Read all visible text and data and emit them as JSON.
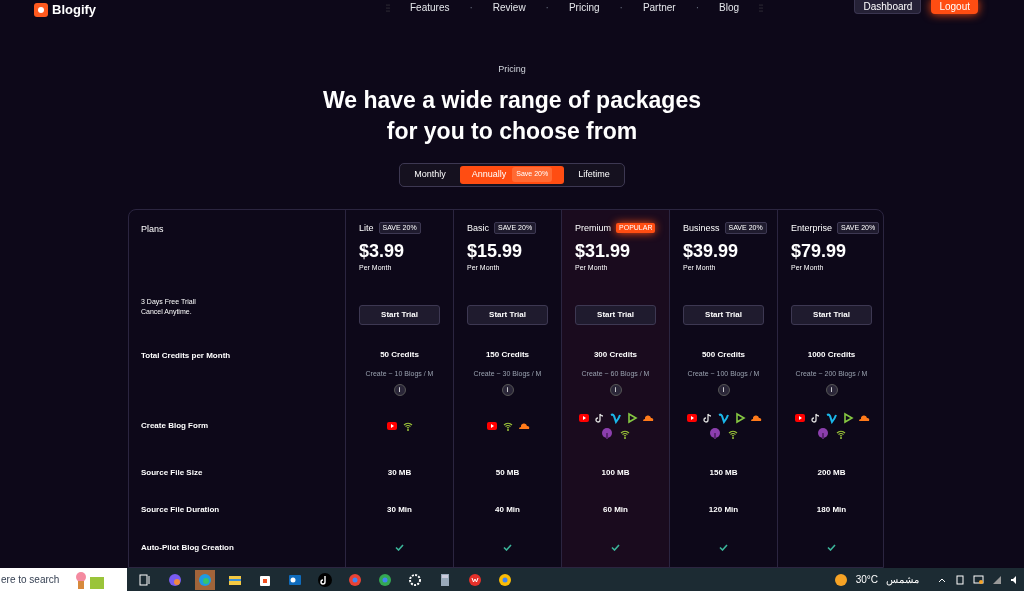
{
  "nav": {
    "brand": "Blogify",
    "links": [
      "Features",
      "Review",
      "Pricing",
      "Partner",
      "Blog"
    ],
    "separator": "·",
    "dashboard": "Dashboard",
    "logout": "Logout"
  },
  "hero": {
    "eyebrow": "Pricing",
    "title_lines": [
      "We have a wide range of packages",
      "for you to choose from"
    ]
  },
  "billing": [
    {
      "label": "Monthly",
      "selected": false
    },
    {
      "label": "Annually",
      "selected": true,
      "badge": "Save 20%"
    },
    {
      "label": "Lifetime",
      "selected": false
    }
  ],
  "plans_header": {
    "label": "Plans",
    "note_lines": [
      "3 Days Free Triall",
      "Cancel Anytime."
    ]
  },
  "plans": [
    {
      "name": "Lite",
      "badge": "SAVE 20%",
      "popular": false,
      "price": "$3.99",
      "period": "Per Month",
      "button": "Start Trial"
    },
    {
      "name": "Basic",
      "badge": "SAVE 20%",
      "popular": false,
      "price": "$15.99",
      "period": "Per Month",
      "button": "Start Trial"
    },
    {
      "name": "Premium",
      "badge": "POPULAR",
      "popular": true,
      "price": "$31.99",
      "period": "Per Month",
      "button": "Start Trial"
    },
    {
      "name": "Business",
      "badge": "SAVE 20%",
      "popular": false,
      "price": "$39.99",
      "period": "Per Month",
      "button": "Start Trial"
    },
    {
      "name": "Enterprise",
      "badge": "SAVE 20%",
      "popular": false,
      "price": "$79.99",
      "period": "Per Month",
      "button": "Start Trial"
    }
  ],
  "features": [
    {
      "kind": "credits",
      "label": "Total Credits per Month",
      "cells": [
        {
          "value": "50 Credits",
          "sub": "Create ~ 10 Blogs / M",
          "info": "i"
        },
        {
          "value": "150 Credits",
          "sub": "Create ~ 30 Blogs / M",
          "info": "i"
        },
        {
          "value": "300 Credits",
          "sub": "Create ~ 60 Blogs / M",
          "info": "i"
        },
        {
          "value": "500 Credits",
          "sub": "Create ~ 100 Blogs / M",
          "info": "i"
        },
        {
          "value": "1000 Credits",
          "sub": "Create ~ 200 Blogs / M",
          "info": "i"
        }
      ]
    },
    {
      "kind": "sources",
      "label": "Create Blog Form",
      "cells": [
        {
          "sources": [
            {
              "kind": "video"
            },
            {
              "kind": "feed"
            }
          ]
        },
        {
          "sources": [
            {
              "kind": "video"
            },
            {
              "kind": "feed"
            },
            {
              "kind": "cloud"
            }
          ]
        },
        {
          "sources": [
            {
              "kind": "video"
            },
            {
              "kind": "note"
            },
            {
              "kind": "v"
            },
            {
              "kind": "play"
            },
            {
              "kind": "cloud"
            },
            {
              "kind": "podcast"
            },
            {
              "kind": "feed"
            }
          ]
        },
        {
          "sources": [
            {
              "kind": "video"
            },
            {
              "kind": "note"
            },
            {
              "kind": "v"
            },
            {
              "kind": "play"
            },
            {
              "kind": "cloud"
            },
            {
              "kind": "podcast"
            },
            {
              "kind": "feed"
            }
          ]
        },
        {
          "sources": [
            {
              "kind": "video"
            },
            {
              "kind": "note"
            },
            {
              "kind": "v"
            },
            {
              "kind": "play"
            },
            {
              "kind": "cloud"
            },
            {
              "kind": "podcast"
            },
            {
              "kind": "feed"
            }
          ]
        }
      ]
    },
    {
      "kind": "text",
      "label": "Source File Size",
      "cells": [
        {
          "value": "30 MB"
        },
        {
          "value": "50 MB"
        },
        {
          "value": "100 MB"
        },
        {
          "value": "150 MB"
        },
        {
          "value": "200 MB"
        }
      ]
    },
    {
      "kind": "text",
      "label": "Source File Duration",
      "cells": [
        {
          "value": "30 Min"
        },
        {
          "value": "40 Min"
        },
        {
          "value": "60 Min"
        },
        {
          "value": "120 Min"
        },
        {
          "value": "180 Min"
        }
      ]
    },
    {
      "kind": "check",
      "label": "Auto-Pilot Blog Creation",
      "cells": [
        {
          "checked": true
        },
        {
          "checked": true
        },
        {
          "checked": true
        },
        {
          "checked": true
        },
        {
          "checked": true
        }
      ]
    }
  ],
  "taskbar": {
    "search": "ere to search",
    "weather_temp": "30°C",
    "weather_text": "مشمس"
  }
}
